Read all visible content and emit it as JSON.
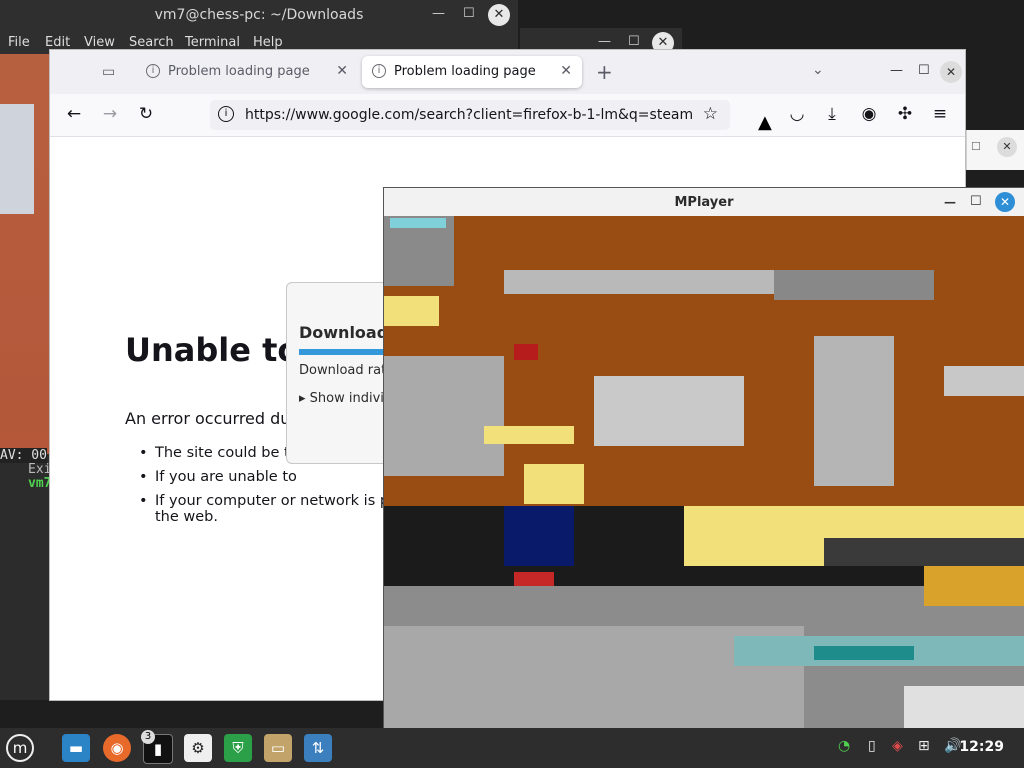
{
  "terminal": {
    "title": "vm7@chess-pc: ~/Downloads",
    "menu": [
      "File",
      "Edit",
      "View",
      "Search",
      "Terminal",
      "Help"
    ],
    "lines": [
      "AV: 00",
      "Exi",
      "vm7"
    ]
  },
  "firefox": {
    "tabs": [
      {
        "label": "Problem loading page",
        "active": false
      },
      {
        "label": "Problem loading page",
        "active": true
      }
    ],
    "new_tab": "+",
    "url": "https://www.google.com/search?client=firefox-b-1-lm&q=steam",
    "error_title": "Unable to",
    "error_desc": "An error occurred du",
    "bullets": [
      "The site could be te",
      "If you are unable to",
      "If your computer or network is pro",
      "the web."
    ]
  },
  "download_dialog": {
    "title": "Downloadi",
    "rate": "Download rat",
    "show": "Show indivi"
  },
  "mplayer": {
    "title": "MPlayer"
  },
  "taskbar": {
    "badge": "3",
    "clock": "12:29"
  },
  "colors": {
    "accent_blue": "#3498db",
    "mint_green": "#2ca048",
    "taskbar": "#2d2d2d"
  }
}
